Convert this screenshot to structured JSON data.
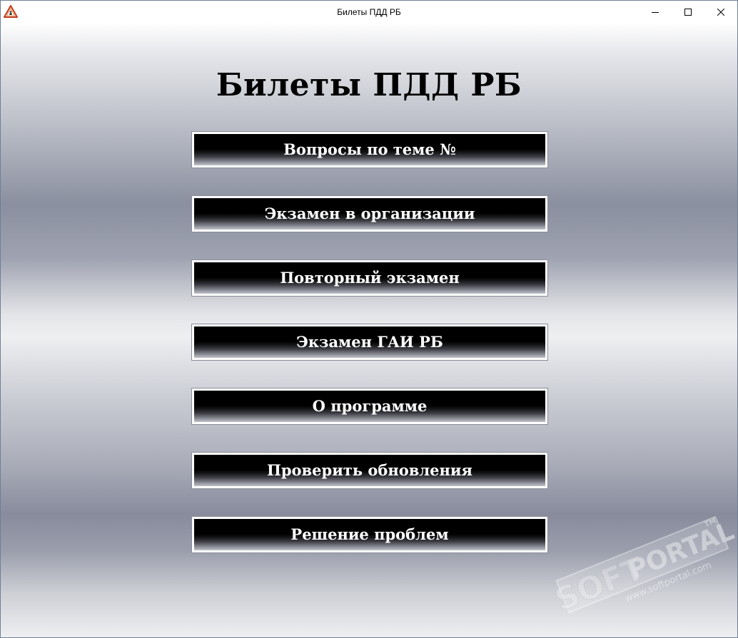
{
  "window": {
    "title": "Билеты ПДД РБ",
    "icon": "warning-triangle-icon"
  },
  "main": {
    "heading": "Билеты ПДД РБ",
    "buttons": [
      {
        "label": "Вопросы по теме №"
      },
      {
        "label": "Экзамен в организации"
      },
      {
        "label": "Повторный экзамен"
      },
      {
        "label": "Экзамен ГАИ РБ"
      },
      {
        "label": "О программе"
      },
      {
        "label": "Проверить обновления"
      },
      {
        "label": "Решение проблем"
      }
    ]
  },
  "watermark": {
    "brand_soft": "SOFT",
    "brand_portal": "PORTAL",
    "trademark": "TM",
    "url": "www.softportal.com"
  }
}
